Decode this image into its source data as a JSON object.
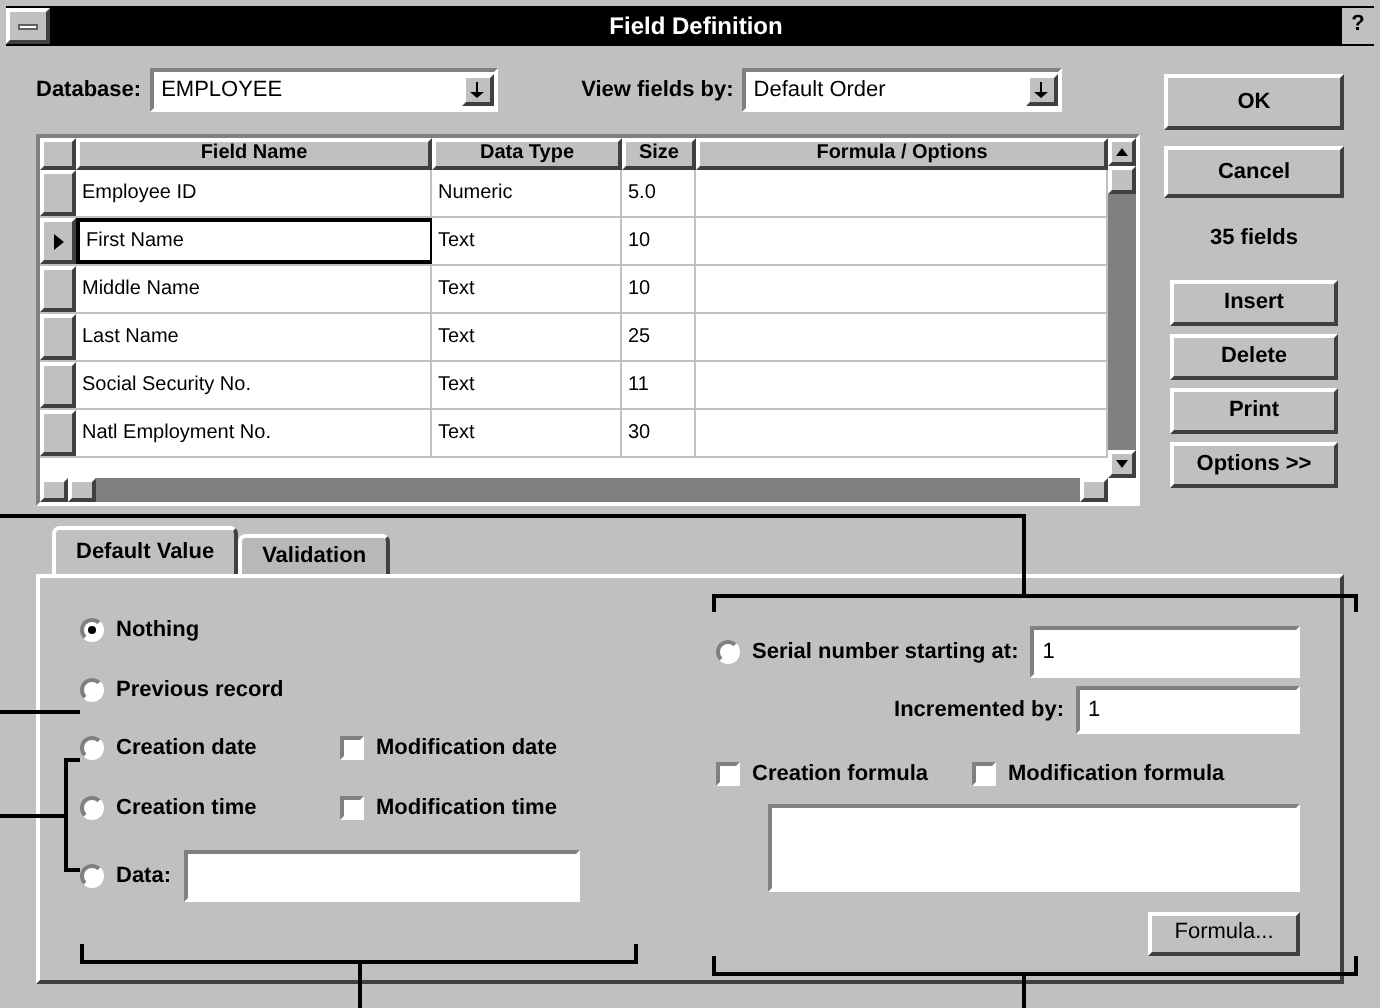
{
  "window": {
    "title": "Field Definition",
    "help": "?"
  },
  "database": {
    "label": "Database:",
    "value": "EMPLOYEE"
  },
  "view_fields_by": {
    "label": "View fields by:",
    "value": "Default Order"
  },
  "table": {
    "columns": [
      "Field Name",
      "Data Type",
      "Size",
      "Formula / Options"
    ],
    "rows": [
      {
        "cells": [
          "Employee ID",
          "Numeric",
          "5.0",
          ""
        ],
        "selected": false
      },
      {
        "cells": [
          "First Name",
          "Text",
          "10",
          ""
        ],
        "selected": true
      },
      {
        "cells": [
          "Middle Name",
          "Text",
          "10",
          ""
        ],
        "selected": false
      },
      {
        "cells": [
          "Last Name",
          "Text",
          "25",
          ""
        ],
        "selected": false
      },
      {
        "cells": [
          "Social Security No.",
          "Text",
          "11",
          ""
        ],
        "selected": false
      },
      {
        "cells": [
          "Natl Employment No.",
          "Text",
          "30",
          ""
        ],
        "selected": false
      }
    ]
  },
  "buttons": {
    "ok": "OK",
    "cancel": "Cancel",
    "count": "35 fields",
    "insert": "Insert",
    "delete": "Delete",
    "print": "Print",
    "options": "Options >>"
  },
  "tabs": [
    {
      "label": "Default Value",
      "selected": true
    },
    {
      "label": "Validation",
      "selected": false
    }
  ],
  "left_options": [
    {
      "kind": "radio",
      "label": "Nothing",
      "checked": true
    },
    {
      "kind": "radio",
      "label": "Previous record",
      "checked": false
    }
  ],
  "date_options": [
    {
      "kind": "radio",
      "label": "Creation date",
      "checked": false
    },
    {
      "kind": "checkbox",
      "label": "Modification date",
      "checked": false
    },
    {
      "kind": "radio",
      "label": "Creation time",
      "checked": false
    },
    {
      "kind": "checkbox",
      "label": "Modification time",
      "checked": false
    }
  ],
  "data_option": {
    "label": "Data:",
    "checked": false
  },
  "serial": {
    "label": "Serial number starting at:",
    "checked": false,
    "value": "1",
    "increment_label": "Incremented by:",
    "increment_value": "1"
  },
  "formula_options": [
    {
      "label": "Creation formula",
      "checked": false
    },
    {
      "label": "Modification formula",
      "checked": false
    }
  ],
  "formula_button": "Formula..."
}
